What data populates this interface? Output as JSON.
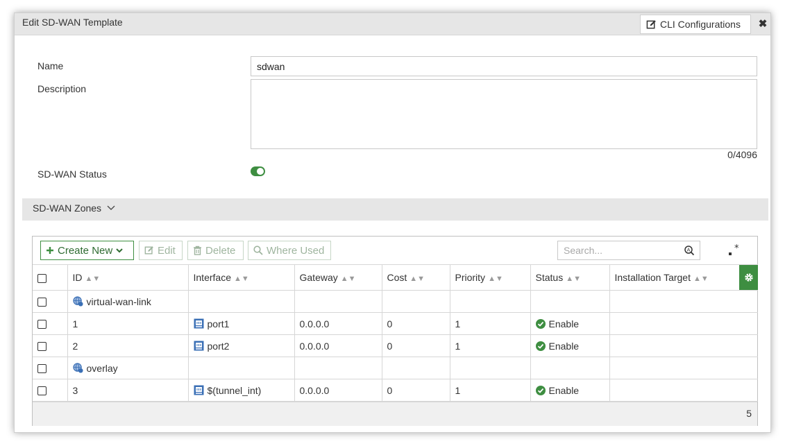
{
  "dialog": {
    "title": "Edit SD-WAN Template",
    "cli_button": "CLI Configurations",
    "close_icon": "close-icon"
  },
  "form": {
    "name_label": "Name",
    "name_value": "sdwan",
    "description_label": "Description",
    "description_value": "",
    "char_counter": "0/4096",
    "status_label": "SD-WAN Status",
    "status_enabled": true
  },
  "zones_section": {
    "title": "SD-WAN Zones"
  },
  "toolbar": {
    "create_new": "Create New",
    "edit": "Edit",
    "delete": "Delete",
    "where_used": "Where Used",
    "search_placeholder": "Search..."
  },
  "table": {
    "columns": [
      "ID",
      "Interface",
      "Gateway",
      "Cost",
      "Priority",
      "Status",
      "Installation Target"
    ],
    "rows": [
      {
        "type": "zone",
        "id": "virtual-wan-link",
        "interface": "",
        "gateway": "",
        "cost": "",
        "priority": "",
        "status": "",
        "target": ""
      },
      {
        "type": "member",
        "id": "1",
        "interface": "port1",
        "gateway": "0.0.0.0",
        "cost": "0",
        "priority": "1",
        "status": "Enable",
        "target": ""
      },
      {
        "type": "member",
        "id": "2",
        "interface": "port2",
        "gateway": "0.0.0.0",
        "cost": "0",
        "priority": "1",
        "status": "Enable",
        "target": ""
      },
      {
        "type": "zone",
        "id": "overlay",
        "interface": "",
        "gateway": "",
        "cost": "",
        "priority": "",
        "status": "",
        "target": ""
      },
      {
        "type": "member",
        "id": "3",
        "interface": "$(tunnel_int)",
        "gateway": "0.0.0.0",
        "cost": "0",
        "priority": "1",
        "status": "Enable",
        "target": ""
      }
    ],
    "total_count": "5"
  },
  "colors": {
    "accent_green": "#3e8e41",
    "header_gray": "#e6e6e6",
    "interface_blue": "#3a6fb5"
  }
}
